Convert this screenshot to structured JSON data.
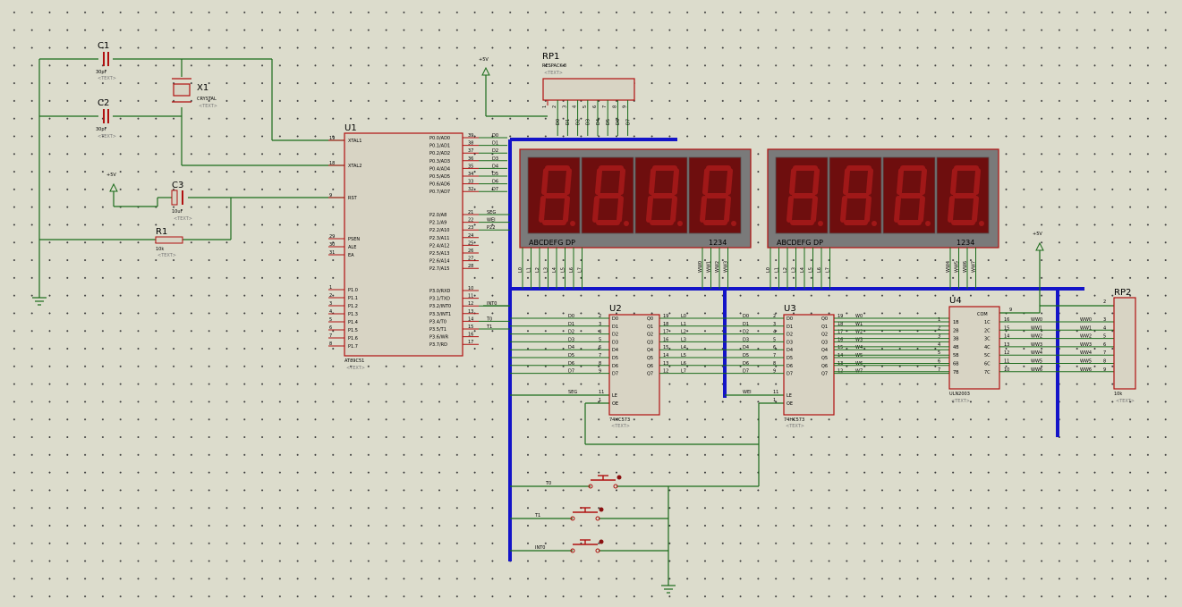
{
  "colors": {
    "wire": "#1a6b1a",
    "bus": "#1414c8",
    "body": "#d8d4c4",
    "outline": "#b01010",
    "display_bg": "#7a1010",
    "segment": "#a01818"
  },
  "text_placeholder": "<TEXT>",
  "components": {
    "c1": {
      "ref": "C1",
      "value": "30pF"
    },
    "c2": {
      "ref": "C2",
      "value": "30pF"
    },
    "c3": {
      "ref": "C3",
      "value": "10uF"
    },
    "x1": {
      "ref": "X1",
      "value": "CRYSTAL"
    },
    "r1": {
      "ref": "R1",
      "value": "10k"
    },
    "rp1": {
      "ref": "RP1",
      "value": "RESPACK-8"
    },
    "rp2": {
      "ref": "RP2",
      "value": "10k"
    },
    "u1": {
      "ref": "U1",
      "value": "AT89C51"
    },
    "u2": {
      "ref": "U2",
      "value": "74HC573"
    },
    "u3": {
      "ref": "U3",
      "value": "74HC573"
    },
    "u4": {
      "ref": "U4",
      "value": "ULN2003"
    }
  },
  "power_labels": {
    "vcc1": "+5V",
    "vcc2": "+5V",
    "vcc3": "+5V"
  },
  "u1_pins": {
    "left_names": [
      "XTAL1",
      "XTAL2",
      "RST",
      "PSEN",
      "ALE",
      "EA",
      "P1.0",
      "P1.1",
      "P1.2",
      "P1.3",
      "P1.4",
      "P1.5",
      "P1.6",
      "P1.7"
    ],
    "left_nums": [
      "19",
      "18",
      "9",
      "29",
      "30",
      "31",
      "1",
      "2",
      "3",
      "4",
      "5",
      "6",
      "7",
      "8"
    ],
    "right_names": [
      "P0.0/AD0",
      "P0.1/AD1",
      "P0.2/AD2",
      "P0.3/AD3",
      "P0.4/AD4",
      "P0.5/AD5",
      "P0.6/AD6",
      "P0.7/AD7",
      "P2.0/A8",
      "P2.1/A9",
      "P2.2/A10",
      "P2.3/A11",
      "P2.4/A12",
      "P2.5/A13",
      "P2.6/A14",
      "P2.7/A15",
      "P3.0/RXD",
      "P3.1/TXD",
      "P3.2/INT0",
      "P3.3/INT1",
      "P3.4/T0",
      "P3.5/T1",
      "P3.6/WR",
      "P3.7/RD"
    ],
    "right_nums": [
      "39",
      "38",
      "37",
      "36",
      "35",
      "34",
      "33",
      "32",
      "21",
      "22",
      "23",
      "24",
      "25",
      "26",
      "27",
      "28",
      "10",
      "11",
      "12",
      "13",
      "14",
      "15",
      "16",
      "17"
    ],
    "right_nets": [
      "D0",
      "D1",
      "D2",
      "D3",
      "D4",
      "D5",
      "D6",
      "D7",
      "SEG",
      "WEI",
      "P22",
      "",
      "",
      "",
      "",
      "",
      "",
      "",
      "INT0",
      "",
      "T0",
      "T1",
      "",
      ""
    ]
  },
  "latch_pins": {
    "inputs": [
      "D0",
      "D1",
      "D2",
      "D3",
      "D4",
      "D5",
      "D6",
      "D7"
    ],
    "outputs": [
      "Q0",
      "Q1",
      "Q2",
      "Q3",
      "Q4",
      "Q5",
      "Q6",
      "Q7"
    ],
    "in_nums": [
      "2",
      "3",
      "4",
      "5",
      "6",
      "7",
      "8",
      "9"
    ],
    "out_nums": [
      "19",
      "18",
      "17",
      "16",
      "15",
      "14",
      "13",
      "12"
    ],
    "le": "LE",
    "oe": "OE",
    "le_num": "11",
    "oe_num": "1"
  },
  "u2_nets": {
    "in": [
      "D0",
      "D1",
      "D2",
      "D3",
      "D4",
      "D5",
      "D6",
      "D7"
    ],
    "out": [
      "L0",
      "L1",
      "L2",
      "L3",
      "L4",
      "L5",
      "L6",
      "L7"
    ],
    "le": "SEG"
  },
  "u3_nets": {
    "in": [
      "D0",
      "D1",
      "D2",
      "D3",
      "D4",
      "D5",
      "D6",
      "D7"
    ],
    "out": [
      "W0",
      "W1",
      "W2",
      "W3",
      "W4",
      "W5",
      "W6",
      "W7"
    ],
    "le": "WEI"
  },
  "u4_pins": {
    "left_nums": [
      "1",
      "2",
      "3",
      "4",
      "5",
      "6",
      "7"
    ],
    "left_names": [
      "1B",
      "2B",
      "3B",
      "4B",
      "5B",
      "6B",
      "7B"
    ],
    "right_names": [
      "1C",
      "2C",
      "3C",
      "4C",
      "5C",
      "6C",
      "7C"
    ],
    "right_nums": [
      "16",
      "15",
      "14",
      "13",
      "12",
      "11",
      "10"
    ],
    "com": "COM",
    "com_num": "9",
    "in_nets": [
      "W0",
      "W1",
      "W2",
      "W3",
      "W4",
      "W5",
      "W6"
    ],
    "out_nets": [
      "WW0",
      "WW1",
      "WW2",
      "WW3",
      "WW4",
      "WW5",
      "WW6"
    ],
    "rp2_nums": [
      "2",
      "3",
      "4",
      "5",
      "6",
      "7",
      "8",
      "9"
    ]
  },
  "rp1_pins": [
    "1",
    "2",
    "3",
    "4",
    "5",
    "6",
    "7",
    "8",
    "9"
  ],
  "rp1_nets": [
    "D0",
    "D1",
    "D2",
    "D3",
    "D4",
    "D5",
    "D6",
    "D7"
  ],
  "display1": {
    "seg_label": "ABCDEFG DP",
    "dig_label": "1234",
    "seg_nets": [
      "L0",
      "L1",
      "L2",
      "L3",
      "L4",
      "L5",
      "L6",
      "L7"
    ],
    "dig_nets": [
      "WW0",
      "WW1",
      "WW2",
      "WW3"
    ]
  },
  "display2": {
    "seg_label": "ABCDEFG DP",
    "dig_label": "1234",
    "seg_nets": [
      "L0",
      "L1",
      "L2",
      "L3",
      "L4",
      "L5",
      "L6",
      "L7"
    ],
    "dig_nets": [
      "WW4",
      "WW5",
      "WW6",
      "WW7"
    ]
  },
  "buttons": [
    "T0",
    "T1",
    "INT0"
  ]
}
